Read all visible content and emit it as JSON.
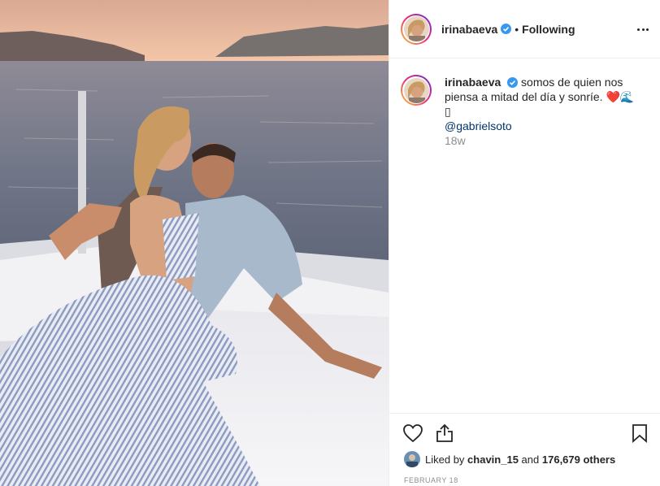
{
  "post": {
    "author": "irinabaeva",
    "verified": true,
    "follow_status": "Following",
    "separator": "•",
    "caption_text": "somos de quien nos piensa a mitad del día y sonríe. ❤️🌊▯",
    "caption_mention": "@gabrielsoto",
    "time_ago": "18w",
    "date": "FEBRUARY 18"
  },
  "likes": {
    "prefix": "Liked by",
    "first_liker": "chavin_15",
    "conjunction": "and",
    "others": "176,679 others"
  },
  "icons": {
    "verified": "verified-badge-icon",
    "more": "more-options-icon",
    "like": "heart-icon",
    "share": "share-icon",
    "save": "bookmark-icon"
  },
  "colors": {
    "verified_blue": "#3897f0",
    "text": "#262626",
    "muted": "#8e8e8e",
    "mention": "#003569"
  }
}
